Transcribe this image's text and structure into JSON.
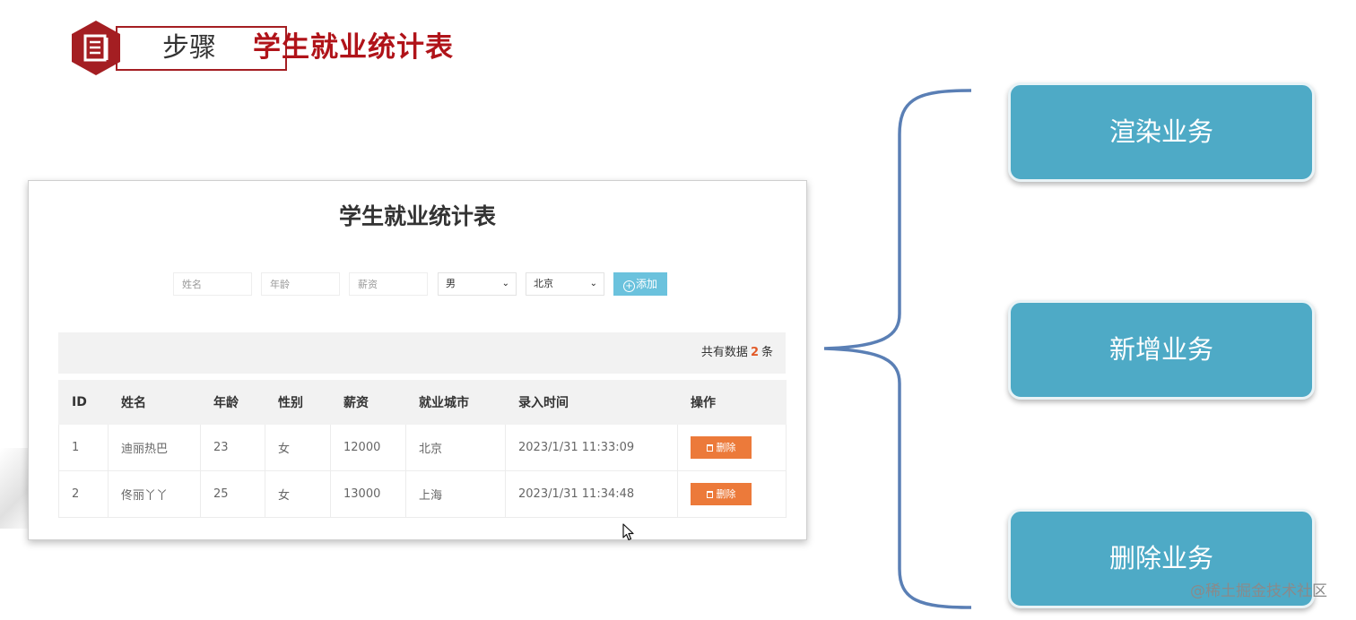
{
  "header": {
    "step_label": "步骤",
    "title": "学生就业统计表"
  },
  "app": {
    "title": "学生就业统计表",
    "form": {
      "name_placeholder": "姓名",
      "age_placeholder": "年龄",
      "salary_placeholder": "薪资",
      "gender_value": "男",
      "city_value": "北京",
      "add_label": "添加"
    },
    "count": {
      "prefix": "共有数据",
      "value": "2",
      "suffix": "条"
    },
    "table": {
      "headers": [
        "ID",
        "姓名",
        "年龄",
        "性别",
        "薪资",
        "就业城市",
        "录入时间",
        "操作"
      ],
      "rows": [
        {
          "id": "1",
          "name": "迪丽热巴",
          "age": "23",
          "gender": "女",
          "salary": "12000",
          "city": "北京",
          "time": "2023/1/31 11:33:09",
          "action": "删除"
        },
        {
          "id": "2",
          "name": "佟丽丫丫",
          "age": "25",
          "gender": "女",
          "salary": "13000",
          "city": "上海",
          "time": "2023/1/31 11:34:48",
          "action": "删除"
        }
      ]
    }
  },
  "business": {
    "render": "渲染业务",
    "add": "新增业务",
    "delete": "删除业务"
  },
  "watermark": "@稀土掘金技术社区",
  "colors": {
    "step_red": "#a41e22",
    "title_red": "#b01319",
    "add_button": "#6bc2dd",
    "delete_button": "#ec7a3a",
    "business_box": "#4eaac6",
    "brace": "#5a7fb5"
  }
}
